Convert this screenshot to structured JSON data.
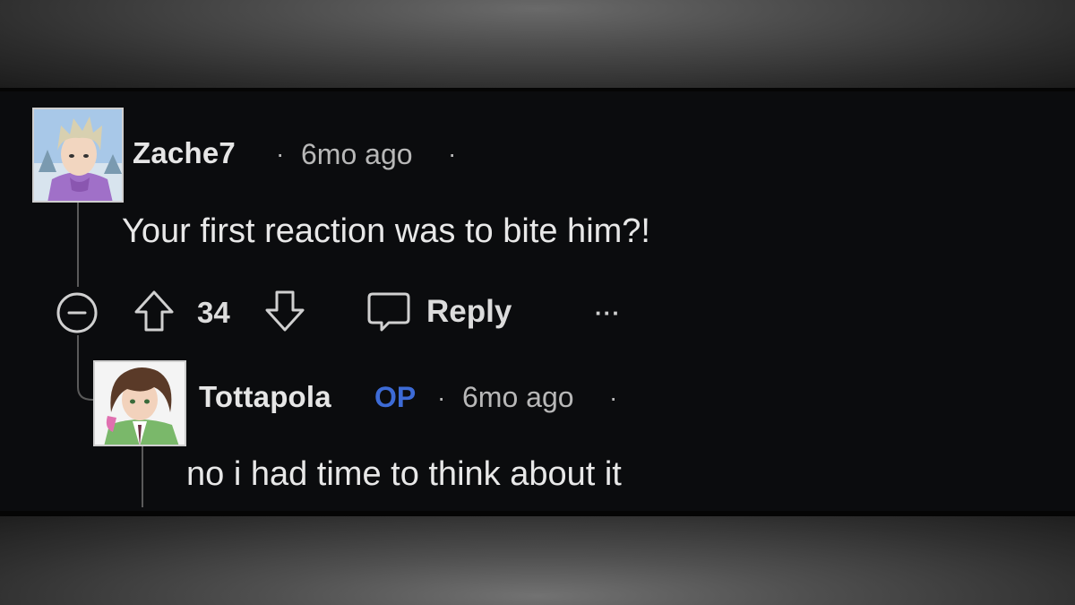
{
  "comments": [
    {
      "username": "Zache7",
      "separator": "·",
      "time": "6mo ago",
      "trailing_separator": "·",
      "text": "Your first reaction was to bite him?!",
      "avatar_icon": "anime-avatar-blonde-purple-jacket",
      "actions": {
        "collapse_icon": "minus-circle-icon",
        "upvote_icon": "arrow-up-icon",
        "score": "34",
        "downvote_icon": "arrow-down-icon",
        "reply_icon": "speech-bubble-icon",
        "reply_label": "Reply",
        "more_label": "···"
      }
    },
    {
      "username": "Tottapola",
      "badge": "OP",
      "separator": "·",
      "time": "6mo ago",
      "trailing_separator": "·",
      "text": "no i had time to think about it",
      "avatar_icon": "anime-avatar-brown-hair-green-jacket"
    }
  ],
  "colors": {
    "background": "#0b0c0e",
    "text": "#e8e8e8",
    "meta": "#b8b8b8",
    "op_badge": "#3d6bd6"
  }
}
